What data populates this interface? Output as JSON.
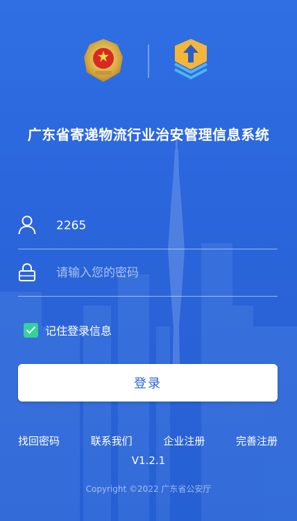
{
  "header": {
    "title": "广东省寄递物流行业治安管理信息系统"
  },
  "login_form": {
    "username": {
      "value": "2265",
      "placeholder": ""
    },
    "password": {
      "value": "",
      "placeholder": "请输入您的密码"
    },
    "remember": {
      "label": "记住登录信息",
      "checked": true
    },
    "submit_label": "登录"
  },
  "links": {
    "forgot_password": "找回密码",
    "contact_us": "联系我们",
    "enterprise_register": "企业注册",
    "complete_register": "完善注册"
  },
  "footer": {
    "version": "V1.2.1",
    "copyright": "Copyright ©2022 广东省公安厅"
  },
  "colors": {
    "background": "#2a63d7",
    "accent_check": "#33d29b",
    "button_text": "#2a63d7"
  },
  "icons": {
    "user": "user-icon",
    "lock": "lock-icon",
    "check": "check-icon"
  }
}
